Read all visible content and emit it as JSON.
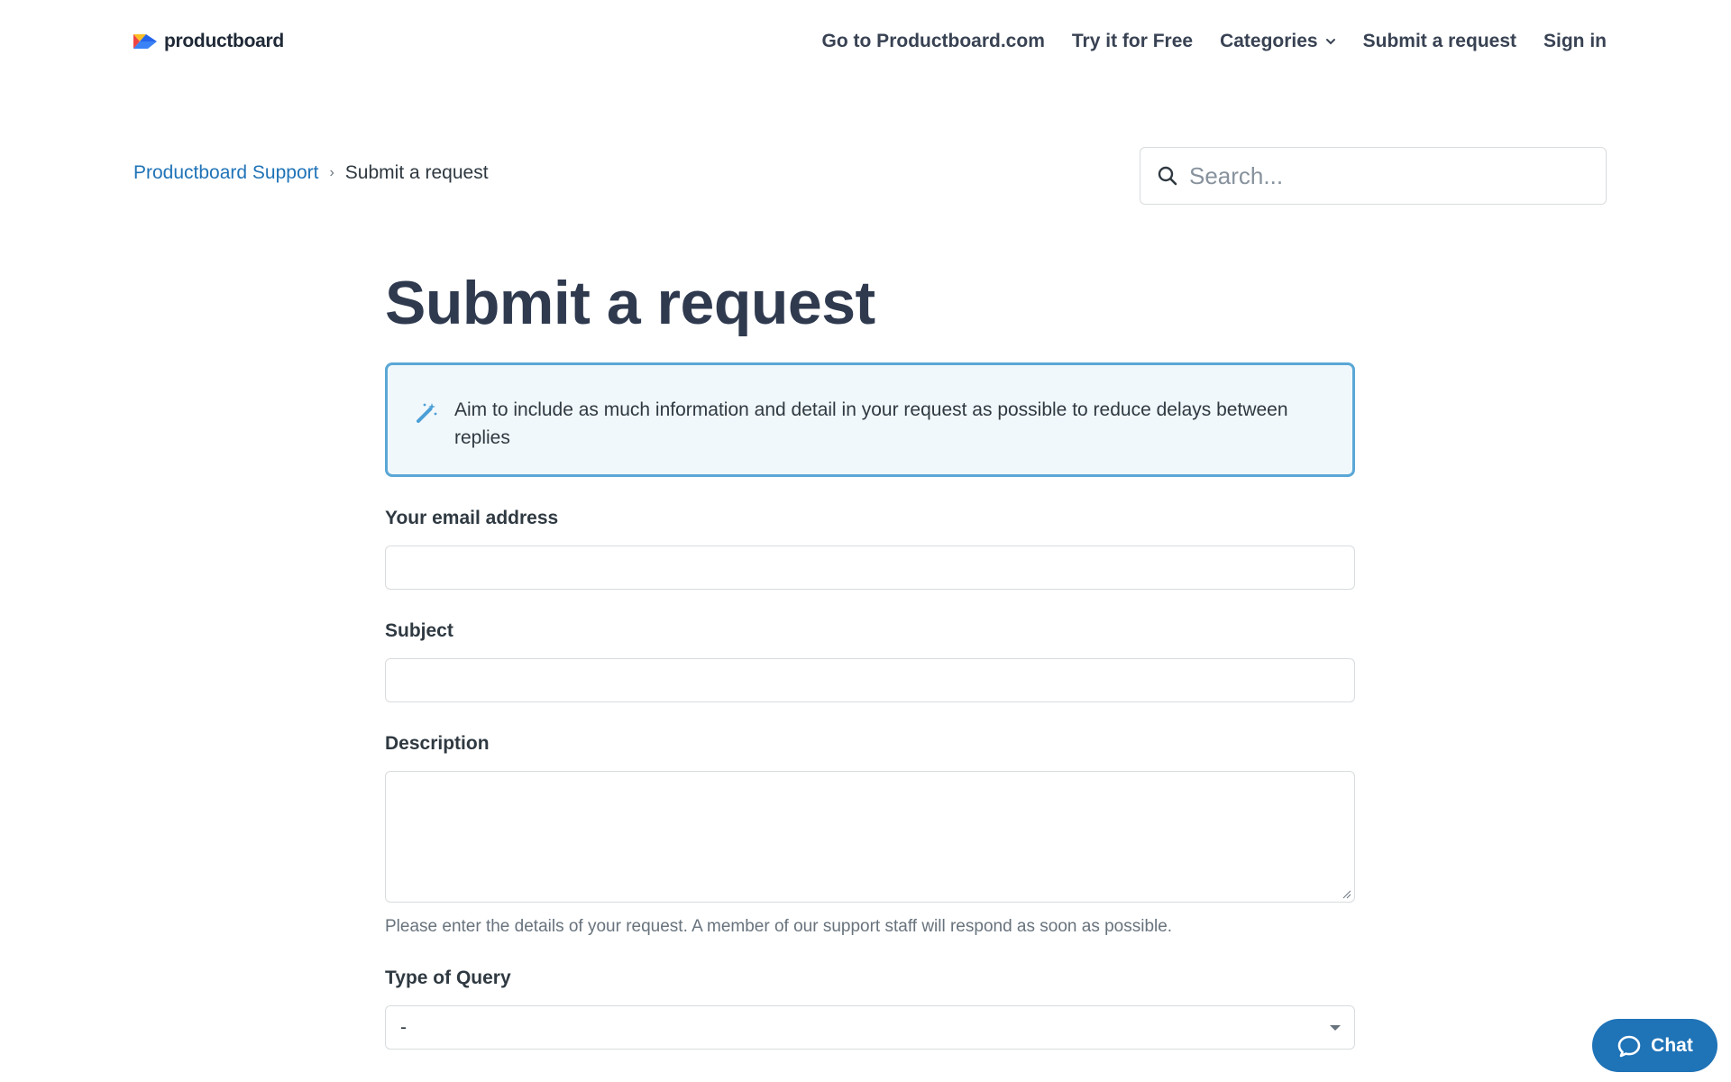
{
  "header": {
    "logo_text": "productboard",
    "nav": {
      "goto": "Go to Productboard.com",
      "try": "Try it for Free",
      "categories": "Categories",
      "submit": "Submit a request",
      "signin": "Sign in"
    }
  },
  "breadcrumb": {
    "home": "Productboard Support",
    "separator": "›",
    "current": "Submit a request"
  },
  "search": {
    "placeholder": "Search..."
  },
  "main": {
    "title": "Submit a request",
    "notice": "Aim to include as much information and detail in your request as possible to reduce delays between replies",
    "fields": {
      "email": {
        "label": "Your email address",
        "value": ""
      },
      "subject": {
        "label": "Subject",
        "value": ""
      },
      "description": {
        "label": "Description",
        "value": "",
        "hint": "Please enter the details of your request. A member of our support staff will respond as soon as possible."
      },
      "query_type": {
        "label": "Type of Query",
        "selected": "-"
      }
    }
  },
  "chat": {
    "label": "Chat"
  },
  "colors": {
    "accent": "#1f73b7",
    "notice_border": "#5aa7d6",
    "notice_bg": "#f1f8fb"
  }
}
